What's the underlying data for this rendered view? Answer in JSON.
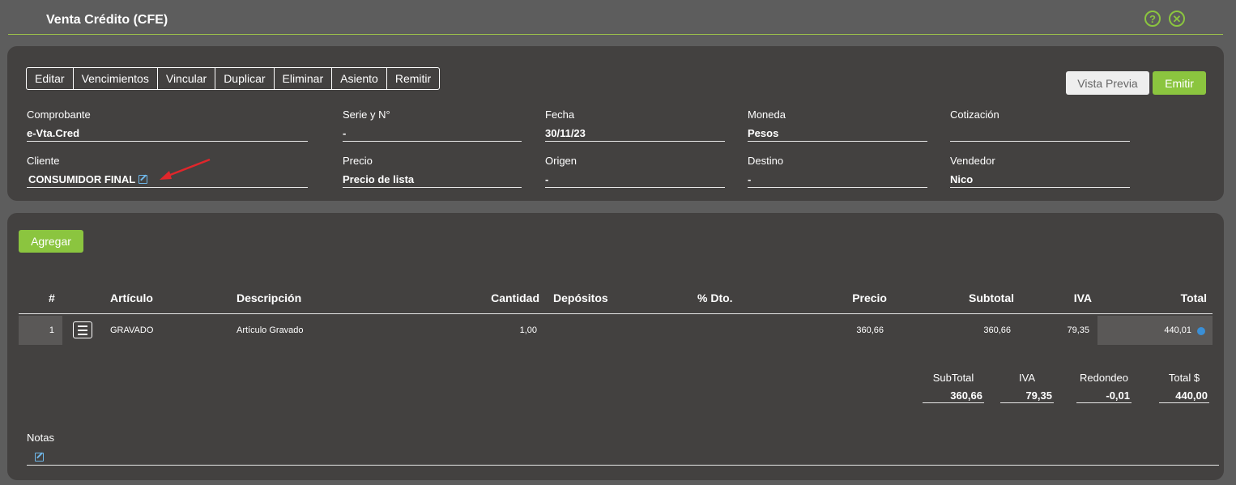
{
  "window": {
    "title": "Venta Crédito (CFE)",
    "help_icon": "?",
    "close_icon": "✕"
  },
  "toolbar": [
    "Editar",
    "Vencimientos",
    "Vincular",
    "Duplicar",
    "Eliminar",
    "Asiento",
    "Remitir"
  ],
  "actions": {
    "preview": "Vista Previa",
    "emit": "Emitir"
  },
  "fields": {
    "comprobante": {
      "label": "Comprobante",
      "value": "e-Vta.Cred"
    },
    "serie": {
      "label": "Serie y N°",
      "value": "-"
    },
    "fecha": {
      "label": "Fecha",
      "value": "30/11/23"
    },
    "moneda": {
      "label": "Moneda",
      "value": "Pesos"
    },
    "cotizacion": {
      "label": "Cotización",
      "value": ""
    },
    "cliente": {
      "label": "Cliente",
      "value": "CONSUMIDOR FINAL"
    },
    "precio": {
      "label": "Precio",
      "value": "Precio de lista"
    },
    "origen": {
      "label": "Origen",
      "value": "-"
    },
    "destino": {
      "label": "Destino",
      "value": "-"
    },
    "vendedor": {
      "label": "Vendedor",
      "value": "Nico"
    }
  },
  "items": {
    "add_label": "Agregar",
    "columns": {
      "num": "#",
      "articulo": "Artículo",
      "descripcion": "Descripción",
      "cantidad": "Cantidad",
      "depositos": "Depósitos",
      "dto": "% Dto.",
      "precio": "Precio",
      "subtotal": "Subtotal",
      "iva": "IVA",
      "total": "Total"
    },
    "rows": [
      {
        "num": "1",
        "articulo": "GRAVADO",
        "descripcion": "Artículo Gravado",
        "cantidad": "1,00",
        "depositos": "",
        "dto": "",
        "precio": "360,66",
        "subtotal": "360,66",
        "iva": "79,35",
        "total": "440,01"
      }
    ]
  },
  "totals": {
    "subtotal": {
      "label": "SubTotal",
      "value": "360,66"
    },
    "iva": {
      "label": "IVA",
      "value": "79,35"
    },
    "redondeo": {
      "label": "Redondeo",
      "value": "-0,01"
    },
    "total": {
      "label": "Total $",
      "value": "440,00"
    }
  },
  "notes": {
    "label": "Notas"
  },
  "colors": {
    "accent": "#8bc53f",
    "panel": "#434140",
    "background": "#5d5d5d",
    "annotation_arrow": "#e0262b"
  }
}
